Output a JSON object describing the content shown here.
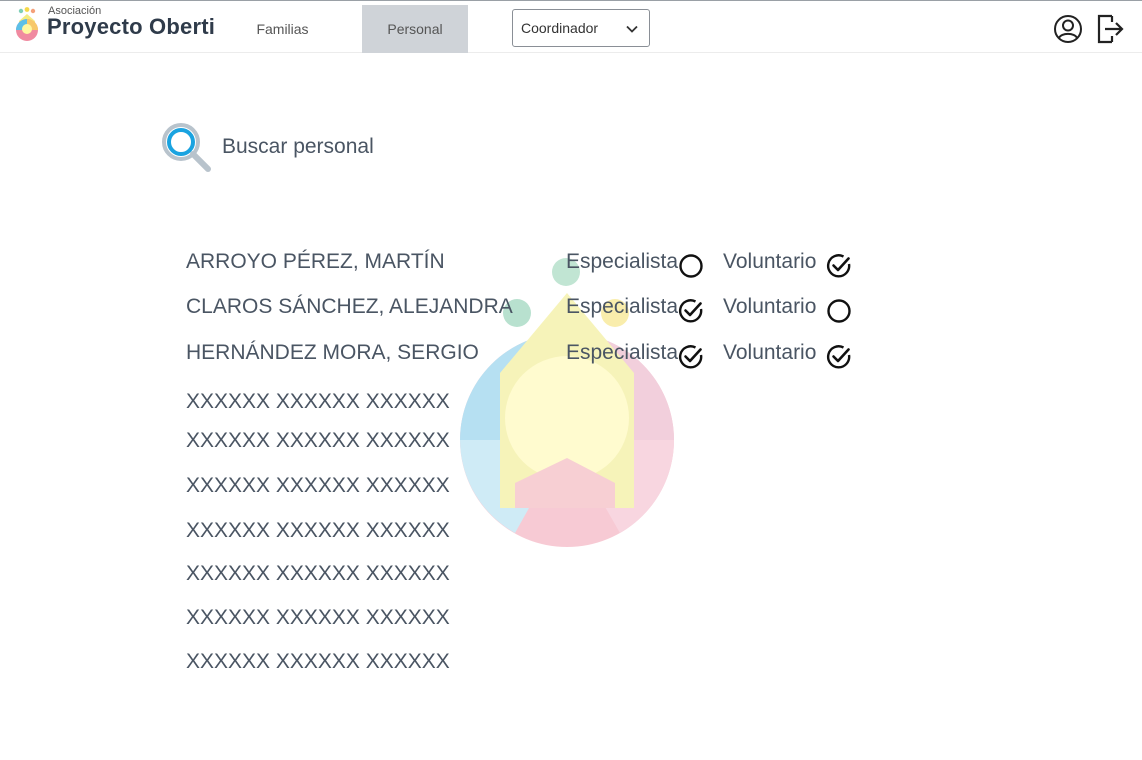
{
  "app": {
    "logo_small": "Asociación",
    "logo_name": "Proyecto Oberti"
  },
  "nav": {
    "familias": "Familias",
    "personal": "Personal",
    "active": "Personal"
  },
  "role_select": {
    "value": "Coordinador"
  },
  "search": {
    "label": "Buscar personal"
  },
  "staff": [
    {
      "name": "ARROYO PÉREZ, MARTÍN",
      "especialista_label": "Especialista",
      "especialista": false,
      "voluntario_label": "Voluntario",
      "voluntario": true
    },
    {
      "name": "CLAROS SÁNCHEZ, ALEJANDRA",
      "especialista_label": "Especialista",
      "especialista": true,
      "voluntario_label": "Voluntario",
      "voluntario": false
    },
    {
      "name": "HERNÁNDEZ MORA, SERGIO",
      "especialista_label": "Especialista",
      "especialista": true,
      "voluntario_label": "Voluntario",
      "voluntario": true
    }
  ],
  "placeholders": [
    "XXXXXX XXXXXX XXXXXX",
    "XXXXXX XXXXXX XXXXXX",
    "XXXXXX XXXXXX XXXXXX",
    "XXXXXX XXXXXX XXXXXX",
    "XXXXXX XXXXXX XXXXXX",
    "XXXXXX XXXXXX XXXXXX",
    "XXXXXX XXXXXX XXXXXX"
  ],
  "icons": {
    "logo": "logo-mark-icon",
    "chevron": "chevron-down-icon",
    "user": "user-circle-icon",
    "logout": "logout-icon",
    "search": "magnifier-icon",
    "checked": "check-circle-icon",
    "unchecked": "empty-circle-icon"
  },
  "colors": {
    "text": "#4a5563",
    "active_tab_bg": "#cfd3d8",
    "search_accent": "#1aa3e0"
  }
}
